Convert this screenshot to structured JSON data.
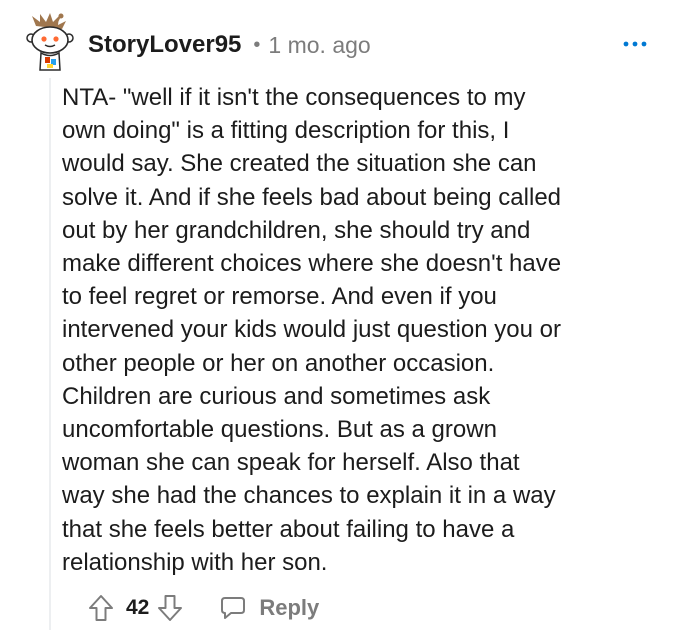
{
  "comment": {
    "author": "StoryLover95",
    "separator": "•",
    "timestamp": "1 mo. ago",
    "more_icon": "more-horizontal-icon",
    "body_lines": [
      "NTA- \"well if it isn't the consequences to my",
      "own doing\" is a fitting description for this, I",
      "would say. She created the situation she can",
      "solve it. And if she feels bad about being called",
      "out by her grandchildren, she should try and",
      "make different choices where she doesn't have",
      "to feel regret or remorse. And even if you",
      "intervened your kids would just question you or",
      "other people or her on another occasion.",
      "Children are curious and sometimes ask",
      "uncomfortable questions. But as a grown",
      "woman she can speak for herself. Also that",
      "way she had the chances to explain it in a way",
      "that she feels better about failing to have a",
      "relationship with her son."
    ],
    "actions": {
      "upvote_icon": "upvote-arrow-icon",
      "score": "42",
      "downvote_icon": "downvote-arrow-icon",
      "reply_icon": "speech-bubble-icon",
      "reply_label": "Reply"
    }
  },
  "colors": {
    "text": "#1c1c1c",
    "meta": "#7c7c7c",
    "thread_line": "#edeff1",
    "more_icon": "#0079d3"
  }
}
